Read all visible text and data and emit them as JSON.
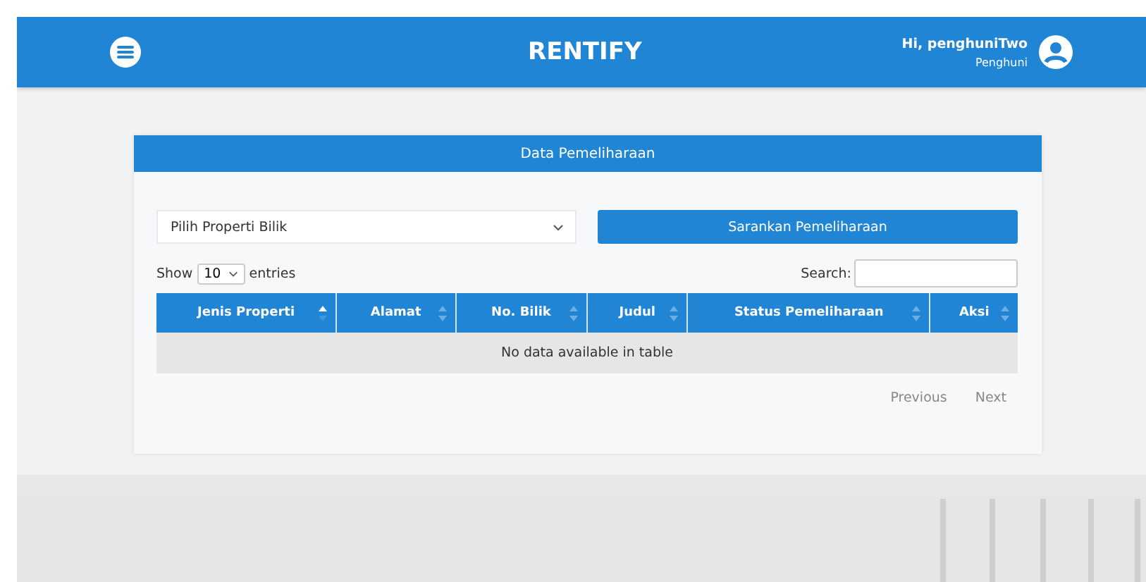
{
  "header": {
    "title": "RENTIFY",
    "greeting": "Hi, penghuniTwo",
    "role": "Penghuni"
  },
  "card": {
    "title": "Data Pemeliharaan",
    "property_select": {
      "value": "Pilih Properti Bilik"
    },
    "suggest_button": "Sarankan Pemeliharaan",
    "length": {
      "before": "Show",
      "value": "10",
      "after": "entries"
    },
    "search": {
      "label": "Search:"
    },
    "table": {
      "columns": [
        {
          "label": "Jenis Properti",
          "sorted": true
        },
        {
          "label": "Alamat",
          "sorted": false
        },
        {
          "label": "No. Bilik",
          "sorted": false
        },
        {
          "label": "Judul",
          "sorted": false
        },
        {
          "label": "Status Pemeliharaan",
          "sorted": false
        },
        {
          "label": "Aksi",
          "sorted": false
        }
      ],
      "empty": "No data available in table"
    },
    "pagination": [
      {
        "label": "Previous",
        "disabled": true
      },
      {
        "label": "Next",
        "disabled": true
      }
    ]
  }
}
